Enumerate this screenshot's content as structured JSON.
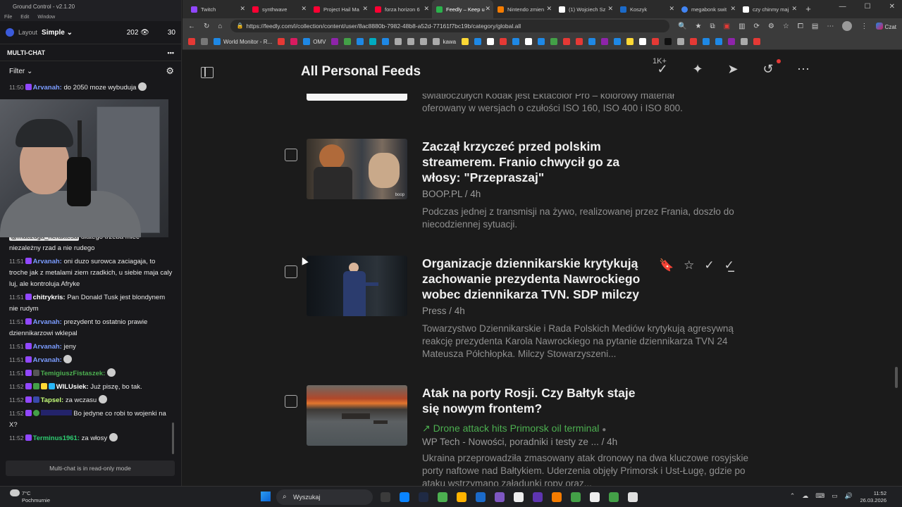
{
  "ground_control": {
    "title": "Ground Control - v2.1.20",
    "menu": [
      "File",
      "Edit",
      "Window"
    ],
    "layout_label": "Layout",
    "layout_value": "Simple",
    "viewers": "202",
    "subs": "30",
    "panel_title": "MULTI-CHAT",
    "filter_label": "Filter",
    "readonly_notice": "Multi-chat is in read-only mode",
    "messages": [
      {
        "time": "11:50",
        "user": "Arvanah:",
        "color": "#7b9cff",
        "text": "do 2050 moze wybuduja"
      },
      {
        "time": "",
        "user": "",
        "color": "#fff",
        "text": "niezależny rzad a nie rudego",
        "mention": "@maczuga_heraktesa",
        "mention_rest": "dlatego trzeba miec"
      },
      {
        "time": "11:51",
        "user": "Arvanah:",
        "color": "#7b9cff",
        "text": "oni duzo surowca zaciagaja, to troche jak z metalami ziem rzadkich, u siebie maja caly luj, ale kontroluja Afryke"
      },
      {
        "time": "11:51",
        "user": "chitrykris:",
        "color": "#ffffff",
        "text": "Pan Donald Tusk jest blondynem nie rudym"
      },
      {
        "time": "11:51",
        "user": "Arvanah:",
        "color": "#7b9cff",
        "text": "prezydent to ostatnio prawie dziennikarzowi wklepal"
      },
      {
        "time": "11:51",
        "user": "Arvanah:",
        "color": "#7b9cff",
        "text": "jeny"
      },
      {
        "time": "11:51",
        "user": "Arvanah:",
        "color": "#7b9cff",
        "text": ""
      },
      {
        "time": "11:51",
        "user": "TemigiuszFistaszek:",
        "color": "#4caf50",
        "text": ""
      },
      {
        "time": "11:52",
        "user": "WILUsiek:",
        "color": "#ffffff",
        "text": "Już piszę, bo tak."
      },
      {
        "time": "11:52",
        "user": "Tapsel:",
        "color": "#c6ff7a",
        "text": "za wczasu"
      },
      {
        "time": "11:52",
        "user": "",
        "color": "#3a3aff",
        "text": "Bo jedyne co robi to wojenki na X?"
      },
      {
        "time": "11:52",
        "user": "Terminus1961:",
        "color": "#2ecc71",
        "text": "za włosy"
      }
    ]
  },
  "browser": {
    "tabs": [
      {
        "label": "Twitch",
        "color": "#9147ff"
      },
      {
        "label": "synthwave",
        "color": "#ff0033"
      },
      {
        "label": "Project Hail Ma",
        "color": "#ff0033"
      },
      {
        "label": "forza horizon 6",
        "color": "#ff0033"
      },
      {
        "label": "Feedly – Keep u",
        "color": "#2bb24c",
        "active": true
      },
      {
        "label": "Nintendo zmien",
        "color": "#f57c00"
      },
      {
        "label": "(1) Wojciech Sz",
        "color": "#ffffff"
      },
      {
        "label": "Koszyk",
        "color": "#1b6ac9"
      },
      {
        "label": "megabonk swit",
        "color": "#4285f4"
      },
      {
        "label": "czy chinmy maj",
        "color": "#ffffff"
      }
    ],
    "url": "https://feedly.com/i/collection/content/user/8ac8880b-7982-48b8-a52d-77161f7bc19b/category/global.all",
    "profile_label": "Czat",
    "bookmarks": [
      {
        "label": "",
        "color": "#e53935"
      },
      {
        "label": "",
        "color": "#777"
      },
      {
        "label": "World Monitor - R...",
        "color": "#1e88e5"
      },
      {
        "label": "",
        "color": "#e53935"
      },
      {
        "label": "",
        "color": "#d81b60"
      },
      {
        "label": "OMV",
        "color": "#1e88e5"
      },
      {
        "label": "",
        "color": "#8e24aa"
      },
      {
        "label": "",
        "color": "#43a047"
      },
      {
        "label": "",
        "color": "#1e88e5"
      },
      {
        "label": "",
        "color": "#00acc1"
      },
      {
        "label": "",
        "color": "#1e88e5"
      },
      {
        "label": "",
        "color": "#aaa"
      },
      {
        "label": "",
        "color": "#aaa"
      },
      {
        "label": "",
        "color": "#aaa"
      },
      {
        "label": "kawa",
        "color": "#aaa"
      },
      {
        "label": "",
        "color": "#fdd835"
      },
      {
        "label": "",
        "color": "#1e88e5"
      },
      {
        "label": "",
        "color": "#fff"
      },
      {
        "label": "",
        "color": "#e53935"
      },
      {
        "label": "",
        "color": "#1e88e5"
      },
      {
        "label": "",
        "color": "#fff"
      },
      {
        "label": "",
        "color": "#1e88e5"
      },
      {
        "label": "",
        "color": "#43a047"
      },
      {
        "label": "",
        "color": "#e53935"
      },
      {
        "label": "",
        "color": "#e53935"
      },
      {
        "label": "",
        "color": "#1e88e5"
      },
      {
        "label": "",
        "color": "#8e24aa"
      },
      {
        "label": "",
        "color": "#1e88e5"
      },
      {
        "label": "",
        "color": "#fdd835"
      },
      {
        "label": "",
        "color": "#fff"
      },
      {
        "label": "",
        "color": "#e53935"
      },
      {
        "label": "",
        "color": "#111"
      },
      {
        "label": "",
        "color": "#aaa"
      },
      {
        "label": "",
        "color": "#e53935"
      },
      {
        "label": "",
        "color": "#1e88e5"
      },
      {
        "label": "",
        "color": "#1e88e5"
      },
      {
        "label": "",
        "color": "#8e24aa"
      },
      {
        "label": "",
        "color": "#aaa"
      },
      {
        "label": "",
        "color": "#e53935"
      }
    ]
  },
  "feedly": {
    "page_title": "All Personal Feeds",
    "unread_badge": "1K+",
    "top_fragment_line1": "światłoczułych Kodak jest Ektacolor Pro – kolorowy materiał",
    "top_fragment_line2": "oferowany w wersjach o czułości ISO 160, ISO 400 i ISO 800.",
    "articles": [
      {
        "title": "Zaczął krzyczeć przed polskim streamerem. Franio chwycił go za włosy: \"Przepraszaj\"",
        "source": "BOOP.PL / 4h",
        "desc": "Podczas jednej z transmisji na żywo, realizowanej przez Frania, doszło do niecodziennej sytuacji.",
        "thumb_caption": "boop"
      },
      {
        "title": "Organizacje dziennikarskie krytykują zachowanie prezydenta Nawrockiego wobec dziennikarza TVN. SDP milczy",
        "source": "Press / 4h",
        "desc": "Towarzystwo Dziennikarskie i Rada Polskich Mediów krytykują agresywną reakcję prezydenta Karola Nawrockiego na pytanie dziennikarza TVN 24 Mateusza Półchłopka. Milczy Stowarzyszeni..."
      },
      {
        "title": "Atak na porty Rosji. Czy Bałtyk staje się nowym frontem?",
        "trend": "Drone attack hits Primorsk oil terminal",
        "source": "WP Tech - Nowości, poradniki i testy ze ... / 4h",
        "desc": "Ukraina przeprowadziła zmasowany atak dronowy na dwa kluczowe rosyjskie porty naftowe nad Bałtykiem. Uderzenia objęły Primorsk i Ust-Ługę, gdzie po ataku wstrzymano załadunki ropy oraz..."
      }
    ]
  },
  "taskbar": {
    "temperature": "7°C",
    "weather": "Pochmurnie",
    "search_placeholder": "Wyszukaj",
    "time": "11:52",
    "date": "26.03.2026",
    "apps": [
      {
        "color": "#3b3b3b"
      },
      {
        "color": "#0a84ff"
      },
      {
        "color": "#1f2a44"
      },
      {
        "color": "#4caf50"
      },
      {
        "color": "#ffb300"
      },
      {
        "color": "#1b6ac9"
      },
      {
        "color": "#7e57c2"
      },
      {
        "color": "#eee"
      },
      {
        "color": "#5e35b1"
      },
      {
        "color": "#f57c00"
      },
      {
        "color": "#43a047"
      },
      {
        "color": "#eee"
      },
      {
        "color": "#43a047"
      },
      {
        "color": "#e0e0e0"
      }
    ]
  }
}
